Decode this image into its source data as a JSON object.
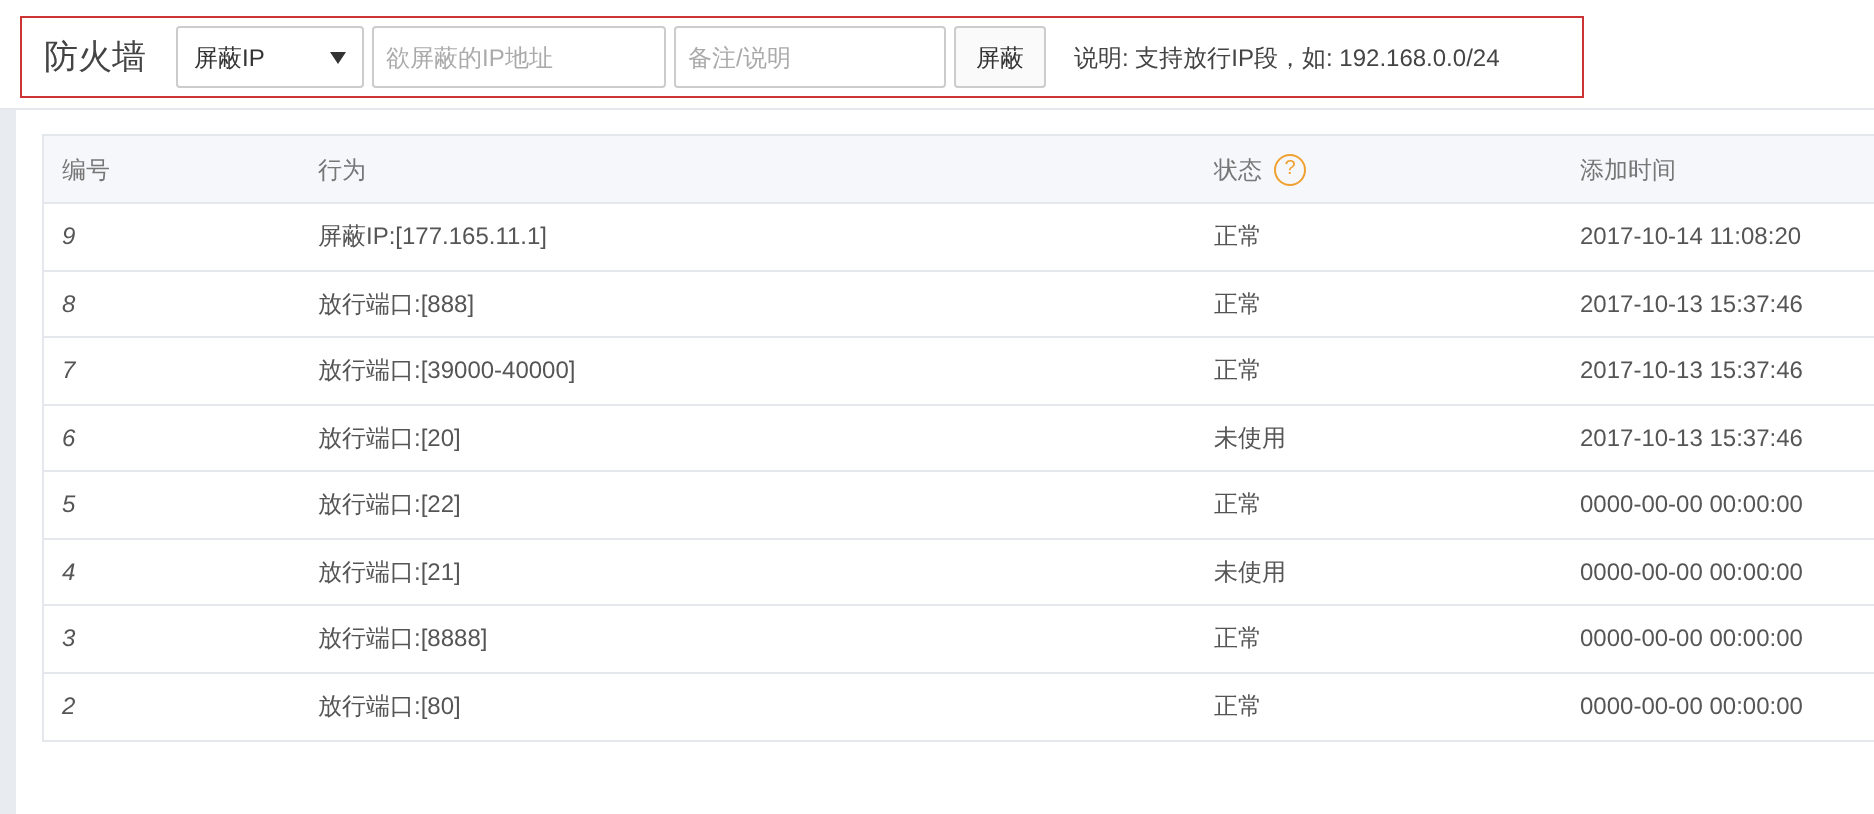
{
  "toolbar": {
    "title": "防火墙",
    "mode_select": {
      "value": "屏蔽IP"
    },
    "ip_field": {
      "placeholder": "欲屏蔽的IP地址"
    },
    "note_field": {
      "placeholder": "备注/说明"
    },
    "submit_button": "屏蔽",
    "hint": "说明: 支持放行IP段，如: 192.168.0.0/24"
  },
  "table": {
    "status_help": "?",
    "columns": [
      "编号",
      "行为",
      "状态",
      "添加时间"
    ],
    "rows": [
      {
        "id": "9",
        "action": "屏蔽IP:[177.165.11.1]",
        "status": "正常",
        "time": "2017-10-14 11:08:20"
      },
      {
        "id": "8",
        "action": "放行端口:[888]",
        "status": "正常",
        "time": "2017-10-13 15:37:46"
      },
      {
        "id": "7",
        "action": "放行端口:[39000-40000]",
        "status": "正常",
        "time": "2017-10-13 15:37:46"
      },
      {
        "id": "6",
        "action": "放行端口:[20]",
        "status": "未使用",
        "time": "2017-10-13 15:37:46"
      },
      {
        "id": "5",
        "action": "放行端口:[22]",
        "status": "正常",
        "time": "0000-00-00 00:00:00"
      },
      {
        "id": "4",
        "action": "放行端口:[21]",
        "status": "未使用",
        "time": "0000-00-00 00:00:00"
      },
      {
        "id": "3",
        "action": "放行端口:[8888]",
        "status": "正常",
        "time": "0000-00-00 00:00:00"
      },
      {
        "id": "2",
        "action": "放行端口:[80]",
        "status": "正常",
        "time": "0000-00-00 00:00:00"
      }
    ]
  }
}
